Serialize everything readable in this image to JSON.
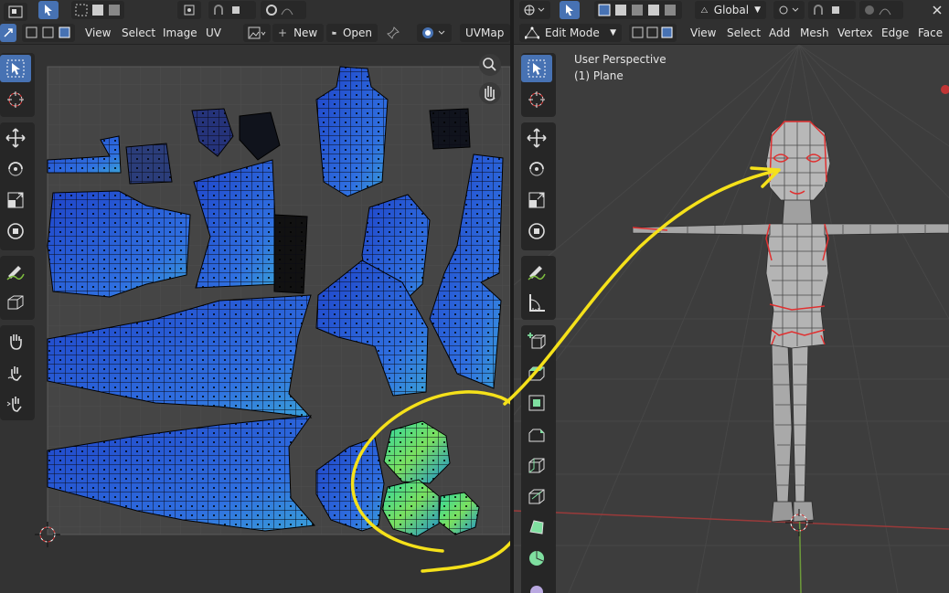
{
  "uv_editor": {
    "header_menus": [
      "View",
      "Select",
      "Image",
      "UV"
    ],
    "new_label": "New",
    "open_label": "Open",
    "uvmap_name": "UVMap"
  },
  "viewport": {
    "transform_orientation": "Global",
    "mode": "Edit Mode",
    "header_menus": [
      "View",
      "Select",
      "Add",
      "Mesh",
      "Vertex",
      "Edge",
      "Face"
    ],
    "overlay_line1": "User Perspective",
    "overlay_line2": "(1) Plane"
  },
  "colors": {
    "accent": "#4772b3",
    "uv_island_fill": "#2f5fd0",
    "uv_island_highlight": "#3fd6a0",
    "annotation": "#f5e11a",
    "mesh_seam": "#e03030",
    "x_axis": "#c44040",
    "y_axis": "#7fbf3f"
  }
}
